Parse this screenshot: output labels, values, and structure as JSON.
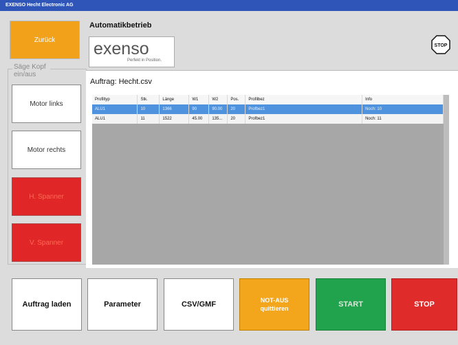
{
  "window": {
    "title": "EXENSO Hecht Electronic AG"
  },
  "nav": {
    "back_label": "Zurück"
  },
  "sidebar": {
    "group_label": "Säge Kopf ein/aus",
    "buttons": [
      "Motor links",
      "Motor rechts",
      "H. Spanner",
      "V. Spanner"
    ]
  },
  "header": {
    "mode": "Automatikbetrieb"
  },
  "logo": {
    "word": "exenso",
    "tagline": "Perfekt in Position."
  },
  "job": {
    "title": "Auftrag: Hecht.csv",
    "columns": [
      "Profiltyp",
      "Stk.",
      "Länge",
      "W1",
      "W2",
      "Pos.",
      "Profilbez",
      "Info"
    ],
    "rows": [
      [
        "ALU1",
        "10",
        "1366",
        "90",
        "90.00",
        "20",
        "Profbez1",
        "Noch: 10"
      ],
      [
        "ALU1",
        "11",
        "1522",
        "45.00",
        "135...",
        "20",
        "Profbez1",
        "Noch: 11"
      ]
    ]
  },
  "bottom": {
    "load": "Auftrag laden",
    "parameter": "Parameter",
    "csv": "CSV/GMF",
    "notaus": "NOT-AUS",
    "notaus_sub": "quittieren",
    "start": "START",
    "stop": "STOP"
  },
  "icons": {
    "stop": "stop-sign-icon"
  },
  "colors": {
    "orange": "#f3a51c",
    "green": "#20a34c",
    "red": "#e02626",
    "title_blue": "#2f55b8",
    "selected_row": "#4f93df"
  }
}
